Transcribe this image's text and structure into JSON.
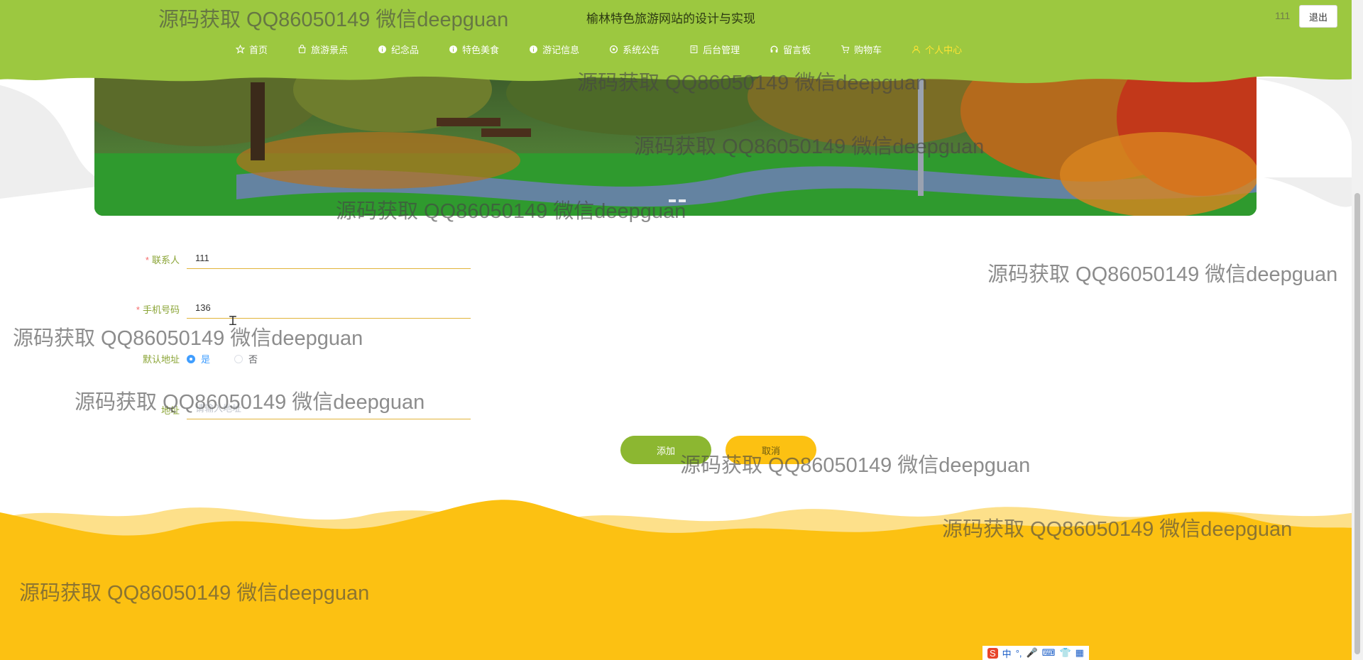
{
  "header": {
    "site_title": "榆林特色旅游网站的设计与实现",
    "user_name": "111",
    "logout_label": "退出",
    "nav": [
      {
        "label": "首页",
        "icon": "star-icon"
      },
      {
        "label": "旅游景点",
        "icon": "bag-icon"
      },
      {
        "label": "纪念品",
        "icon": "info-circle-icon"
      },
      {
        "label": "特色美食",
        "icon": "info-circle-icon"
      },
      {
        "label": "游记信息",
        "icon": "info-circle-icon"
      },
      {
        "label": "系统公告",
        "icon": "settings-circle-icon"
      },
      {
        "label": "后台管理",
        "icon": "building-icon"
      },
      {
        "label": "留言板",
        "icon": "headset-icon"
      },
      {
        "label": "购物车",
        "icon": "cart-icon"
      },
      {
        "label": "个人中心",
        "icon": "user-icon",
        "active": true
      }
    ]
  },
  "form": {
    "contact_label": "联系人",
    "contact_value": "111",
    "phone_label": "手机号码",
    "phone_value": "136",
    "default_label": "默认地址",
    "default_yes": "是",
    "default_no": "否",
    "default_selected": "是",
    "address_label": "地址",
    "address_placeholder": "请输入地址",
    "address_value": "",
    "add_button": "添加",
    "cancel_button": "取消"
  },
  "watermark": "源码获取 QQ86050149 微信deepguan",
  "ime": {
    "label": "中"
  },
  "colors": {
    "header_green": "#9cc840",
    "active_nav": "#ffe433",
    "footer_yellow": "#fcc112",
    "label_green": "#8aa435",
    "add_button": "#8cb731",
    "cancel_button": "#fcc112"
  }
}
